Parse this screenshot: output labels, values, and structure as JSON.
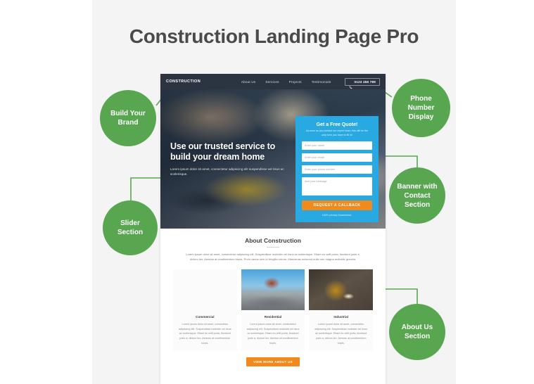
{
  "page": {
    "title": "Construction Landing Page Pro"
  },
  "site": {
    "header": {
      "logo": "CONSTRUCTION",
      "nav": [
        {
          "label": "About Us"
        },
        {
          "label": "Services"
        },
        {
          "label": "Projects"
        },
        {
          "label": "Testimonials"
        }
      ],
      "phone": "0123 456 789",
      "phone_icon": "phone-icon"
    },
    "hero": {
      "title_line1": "Use our trusted service to",
      "title_line2": "build your dream home",
      "subtitle": "Lorem ipsum dolor sit amet, consectetur adipiscing elit suspendisse vel risus ac scelerisque."
    },
    "quote_form": {
      "title": "Get a Free Quote!",
      "subtitle": "As soon as you contact our expert team, this will be the only form you have to fill in!",
      "fields": [
        {
          "placeholder": "Enter your name"
        },
        {
          "placeholder": "Enter your email"
        },
        {
          "placeholder": "Enter your phone number"
        },
        {
          "placeholder": "Add your message"
        }
      ],
      "submit_label": "REQUEST A CALLBACK",
      "privacy_note": "100% privacy Guaranteed."
    },
    "about": {
      "title": "About Construction",
      "text": "Lorem ipsum dolor sit amet, consectetur adipiscing elit. Suspendisse molestie vel risus ac scelerisque. Etiam eu velit porta, tincidunt justo a, dictum leo. Aenean at condimentum turpis. Proin varius sem id fringilla rutrum. Maecenas euismod nulla non magna molestie gravida.",
      "cards": [
        {
          "title": "Commercial",
          "text": "Lorem ipsum dolor sit amet, consectetur adipiscing elit. Suspendisse molestie vel risus ac scelerisque. Etiam eu velit porta, tincidunt justo a, dictum leo. Aenean at condimentum turpis.",
          "image": "worker-carrying-plywood-photo"
        },
        {
          "title": "Residential",
          "text": "Lorem ipsum dolor sit amet, consectetur adipiscing elit. Suspendisse molestie vel risus ac scelerisque. Etiam eu velit porta, tincidunt justo a, dictum leo. Aenean at condimentum turpis.",
          "image": "roofer-on-rooftop-photo"
        },
        {
          "title": "Industrial",
          "text": "Lorem ipsum dolor sit amet, consectetur adipiscing elit. Suspendisse molestie vel risus ac scelerisque. Etiam eu velit porta, tincidunt justo a, dictum leo. Aenean at condimentum turpis.",
          "image": "welder-at-work-photo"
        }
      ],
      "more_button": "VIEW MORE ABOUT US"
    }
  },
  "callouts": [
    {
      "id": "build-your-brand",
      "label": "Build Your Brand"
    },
    {
      "id": "slider-section",
      "label": "Slider Section"
    },
    {
      "id": "phone-number-display",
      "label": "Phone Number Display"
    },
    {
      "id": "banner-with-contact",
      "label": "Banner with Contact Section"
    },
    {
      "id": "about-us-section",
      "label": "About Us Section"
    }
  ],
  "colors": {
    "callout_green": "#58a750",
    "accent_blue": "#29a9e1",
    "accent_orange": "#f18a1c",
    "header_dark": "#2b3440",
    "page_bg": "#f4f4f4"
  }
}
